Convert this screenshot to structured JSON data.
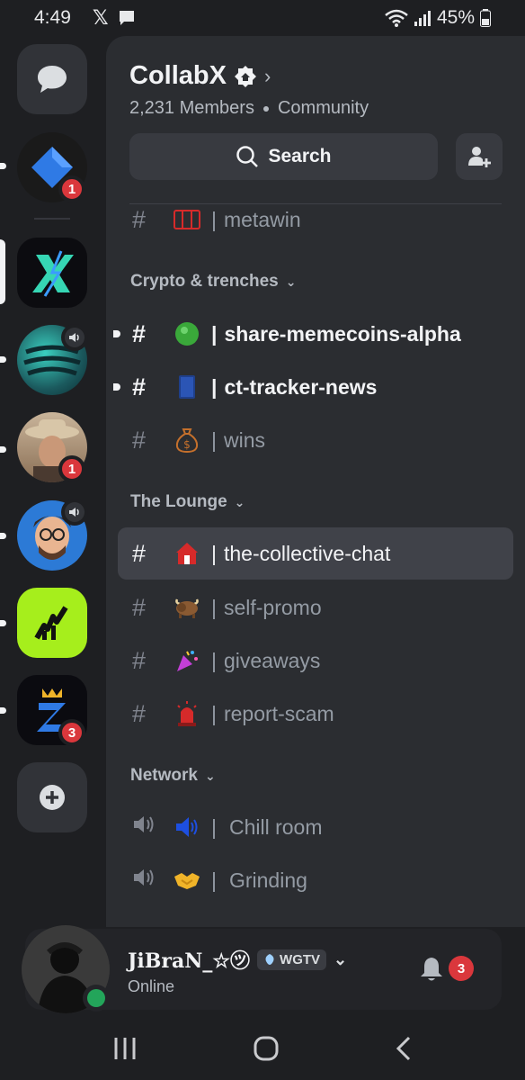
{
  "status_bar": {
    "time": "4:49",
    "battery": "45%"
  },
  "servers": [
    {
      "name": "direct-messages"
    },
    {
      "name": "server-1",
      "badge": "1"
    },
    {
      "name": "server-x"
    },
    {
      "name": "server-globe"
    },
    {
      "name": "server-cowboy",
      "badge": "1"
    },
    {
      "name": "server-cartoon"
    },
    {
      "name": "server-green"
    },
    {
      "name": "server-z",
      "badge": "3"
    },
    {
      "name": "add-server"
    }
  ],
  "guild": {
    "name": "CollabX",
    "members": "2,231 Members",
    "type": "Community"
  },
  "search": {
    "label": "Search"
  },
  "channels": [
    {
      "name": "metawin",
      "sep": "|"
    },
    {
      "name": "share-memecoins-alpha",
      "sep": "|"
    },
    {
      "name": "ct-tracker-news",
      "sep": "|"
    },
    {
      "name": "wins",
      "sep": "|"
    },
    {
      "name": "the-collective-chat",
      "sep": "|"
    },
    {
      "name": "self-promo",
      "sep": "|"
    },
    {
      "name": "giveaways",
      "sep": "|"
    },
    {
      "name": "report-scam",
      "sep": "|"
    },
    {
      "name": "Chill room",
      "sep": "|"
    },
    {
      "name": "Grinding",
      "sep": "|"
    }
  ],
  "categories": [
    {
      "name": "Crypto & trenches"
    },
    {
      "name": "The Lounge"
    },
    {
      "name": "Network"
    }
  ],
  "user": {
    "name": "JiBraN_☆㋡",
    "tag": "WGTV",
    "status": "Online",
    "notifications": "3"
  },
  "colors": {
    "accent": "#5865f2",
    "online": "#23a55a",
    "badge": "#da373c"
  }
}
